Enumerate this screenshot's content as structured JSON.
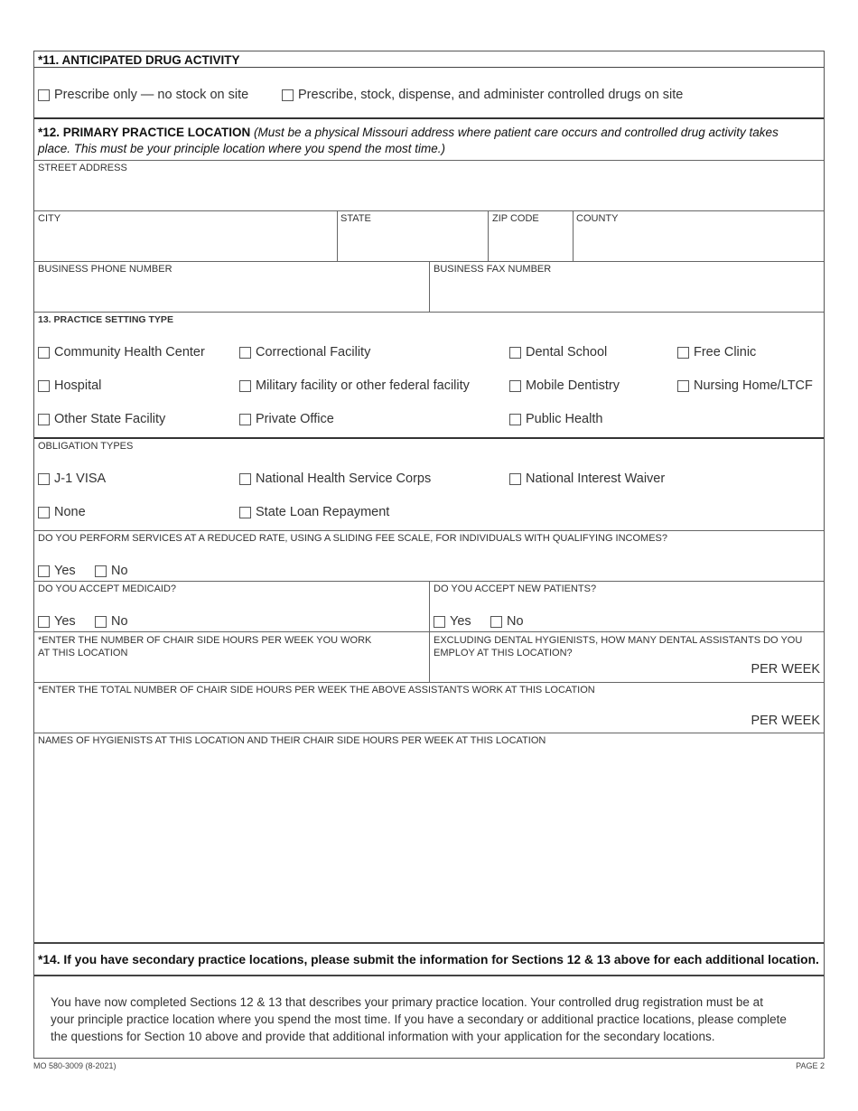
{
  "section11": {
    "title": "*11. ANTICIPATED DRUG ACTIVITY",
    "options": [
      "Prescribe only — no stock on site",
      "Prescribe, stock, dispense, and administer controlled drugs on site"
    ]
  },
  "section12": {
    "title_bold": "*12. PRIMARY PRACTICE LOCATION",
    "title_italic_line1": "(Must be a physical Missouri address where patient care occurs and controlled drug activity takes",
    "title_italic_line2": "place. This must be your principle location where you spend the most time.)",
    "fields": {
      "street": "STREET ADDRESS",
      "city": "CITY",
      "state": "STATE",
      "zip": "ZIP CODE",
      "county": "COUNTY",
      "phone": "BUSINESS PHONE NUMBER",
      "fax": "BUSINESS FAX NUMBER"
    }
  },
  "section13": {
    "title": "13. PRACTICE SETTING TYPE",
    "settings": [
      "Community Health Center",
      "Correctional Facility",
      "Dental School",
      "Free Clinic",
      "Hospital",
      "Military facility or other federal facility",
      "Mobile Dentistry",
      "Nursing Home/LTCF",
      "Other State Facility",
      "Private Office",
      "Public Health"
    ],
    "obligation_title": "OBLIGATION TYPES",
    "obligations": [
      "J-1 VISA",
      "National Health Service Corps",
      "National Interest Waiver",
      "None",
      "State Loan Repayment"
    ],
    "sliding_fee_q": "DO YOU PERFORM SERVICES AT A REDUCED RATE, USING A SLIDING FEE SCALE, FOR INDIVIDUALS WITH QUALIFYING INCOMES?",
    "medicaid_q": "DO YOU ACCEPT MEDICAID?",
    "new_patients_q": "DO YOU ACCEPT NEW PATIENTS?",
    "yes": "Yes",
    "no": "No",
    "chair_hours_q_line1": "*ENTER THE NUMBER OF CHAIR SIDE HOURS PER WEEK YOU WORK",
    "chair_hours_q_line2": "AT THIS LOCATION",
    "assistants_q_line1": "EXCLUDING DENTAL HYGIENISTS, HOW MANY DENTAL ASSISTANTS DO YOU",
    "assistants_q_line2": "EMPLOY AT THIS LOCATION?",
    "per_week": "PER WEEK",
    "assistant_hours_q": "*ENTER THE TOTAL NUMBER OF CHAIR SIDE HOURS PER WEEK THE ABOVE ASSISTANTS WORK AT THIS LOCATION",
    "hygienists_q": "NAMES OF HYGIENISTS AT THIS LOCATION AND THEIR CHAIR SIDE HOURS PER WEEK AT THIS LOCATION"
  },
  "section14": {
    "title": "*14. If you have secondary practice locations, please submit the information for Sections 12 & 13 above for each additional location.",
    "paragraph_line1": "You have now completed Sections 12 & 13 that describes your primary practice location. Your controlled drug registration must be at",
    "paragraph_line2": "your principle practice location where you spend the most time. If you have a secondary or additional practice locations, please complete",
    "paragraph_line3": "the questions for Section 10 above and provide that additional information with your application for the secondary locations."
  },
  "footer": {
    "form_number": "MO 580-3009 (8-2021)",
    "page": "PAGE 2"
  }
}
